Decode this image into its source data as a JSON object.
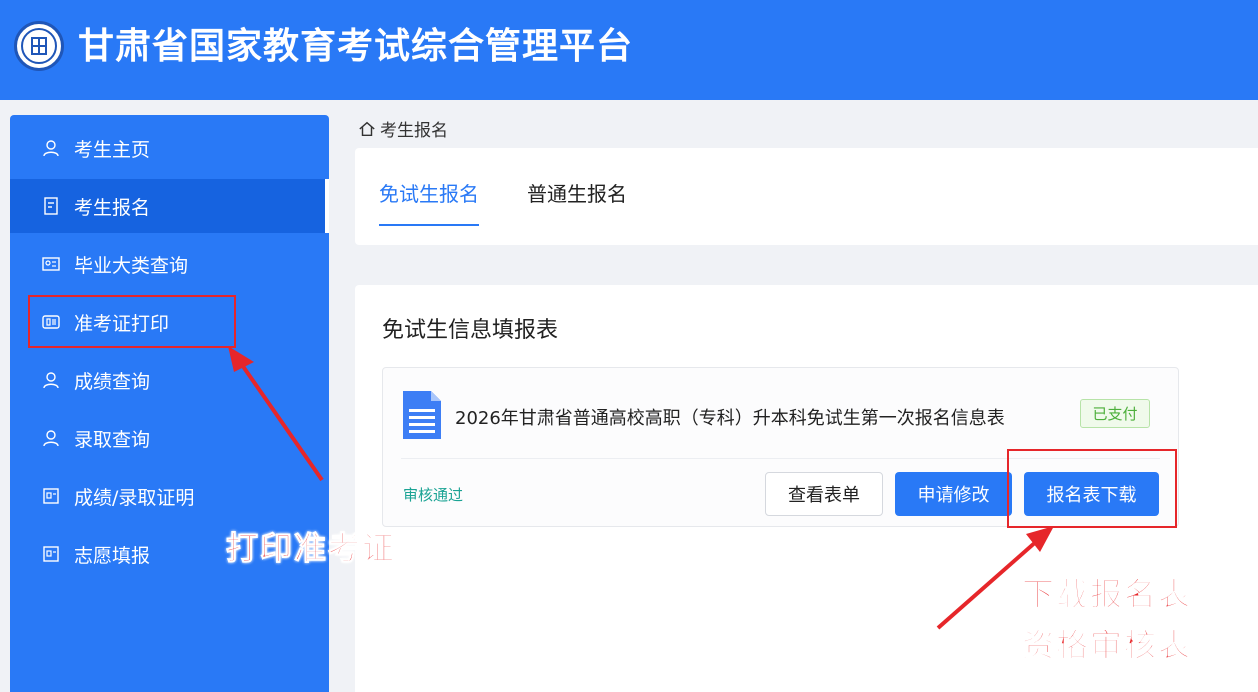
{
  "header": {
    "title": "甘肃省国家教育考试综合管理平台"
  },
  "sidebar": {
    "items": [
      {
        "label": "考生主页",
        "icon": "user-icon"
      },
      {
        "label": "考生报名",
        "icon": "document-icon"
      },
      {
        "label": "毕业大类查询",
        "icon": "id-card-icon"
      },
      {
        "label": "准考证打印",
        "icon": "ticket-icon"
      },
      {
        "label": "成绩查询",
        "icon": "user-icon"
      },
      {
        "label": "录取查询",
        "icon": "user-icon"
      },
      {
        "label": "成绩/录取证明",
        "icon": "certificate-icon"
      },
      {
        "label": "志愿填报",
        "icon": "certificate-icon"
      }
    ],
    "active_index": 1
  },
  "breadcrumb": {
    "label": "考生报名"
  },
  "tabs": [
    {
      "label": "免试生报名",
      "active": true
    },
    {
      "label": "普通生报名",
      "active": false
    }
  ],
  "main": {
    "section_title": "免试生信息填报表",
    "form": {
      "name": "2026年甘肃省普通高校高职（专科）升本科免试生第一次报名信息表",
      "badge": "已支付",
      "status": "审核通过",
      "buttons": {
        "view": "查看表单",
        "edit": "申请修改",
        "download": "报名表下载"
      }
    }
  },
  "annotations": {
    "print_ticket": "打印准考证",
    "download_line1": "下载报名表",
    "download_line2": "资格审核表"
  },
  "colors": {
    "primary": "#2979f6",
    "sidebar_active": "#1663e0",
    "annotation_red": "#e6262a",
    "status_green": "#1aa394",
    "badge_green": "#4caf3a"
  }
}
